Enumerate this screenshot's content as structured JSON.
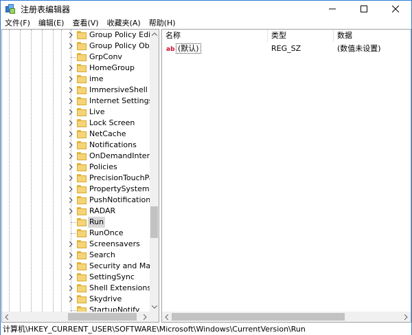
{
  "window": {
    "title": "注册表编辑器",
    "icon": "registry-editor-icon"
  },
  "menu": {
    "items": [
      "文件(F)",
      "编辑(E)",
      "查看(V)",
      "收藏夹(A)",
      "帮助(H)"
    ]
  },
  "tree": {
    "items": [
      {
        "label": "Group Policy Editor",
        "expandable": true
      },
      {
        "label": "Group Policy Objec",
        "expandable": true
      },
      {
        "label": "GrpConv",
        "expandable": false
      },
      {
        "label": "HomeGroup",
        "expandable": true
      },
      {
        "label": "ime",
        "expandable": true
      },
      {
        "label": "ImmersiveShell",
        "expandable": true
      },
      {
        "label": "Internet Settings",
        "expandable": true
      },
      {
        "label": "Live",
        "expandable": true
      },
      {
        "label": "Lock Screen",
        "expandable": true
      },
      {
        "label": "NetCache",
        "expandable": true
      },
      {
        "label": "Notifications",
        "expandable": true
      },
      {
        "label": "OnDemandInterface",
        "expandable": true
      },
      {
        "label": "Policies",
        "expandable": true
      },
      {
        "label": "PrecisionTouchPad",
        "expandable": true
      },
      {
        "label": "PropertySystem",
        "expandable": true
      },
      {
        "label": "PushNotifications",
        "expandable": true
      },
      {
        "label": "RADAR",
        "expandable": true
      },
      {
        "label": "Run",
        "expandable": false,
        "selected": true
      },
      {
        "label": "RunOnce",
        "expandable": false
      },
      {
        "label": "Screensavers",
        "expandable": true
      },
      {
        "label": "Search",
        "expandable": true
      },
      {
        "label": "Security and Mainte",
        "expandable": true
      },
      {
        "label": "SettingSync",
        "expandable": true
      },
      {
        "label": "Shell Extensions",
        "expandable": true
      },
      {
        "label": "Skydrive",
        "expandable": true
      },
      {
        "label": "StartupNotify",
        "expandable": false
      }
    ]
  },
  "list": {
    "columns": [
      "名称",
      "类型",
      "数据"
    ],
    "rows": [
      {
        "name": "(默认)",
        "type": "REG_SZ",
        "data": "(数值未设置)",
        "icon": "string-value-icon"
      }
    ]
  },
  "status": {
    "path": "计算机\\HKEY_CURRENT_USER\\SOFTWARE\\Microsoft\\Windows\\CurrentVersion\\Run"
  },
  "colors": {
    "window_border": "#2b7bd6",
    "folder": "#f5d478",
    "selection": "#d9d9d9",
    "string_icon": "#c8102e"
  }
}
